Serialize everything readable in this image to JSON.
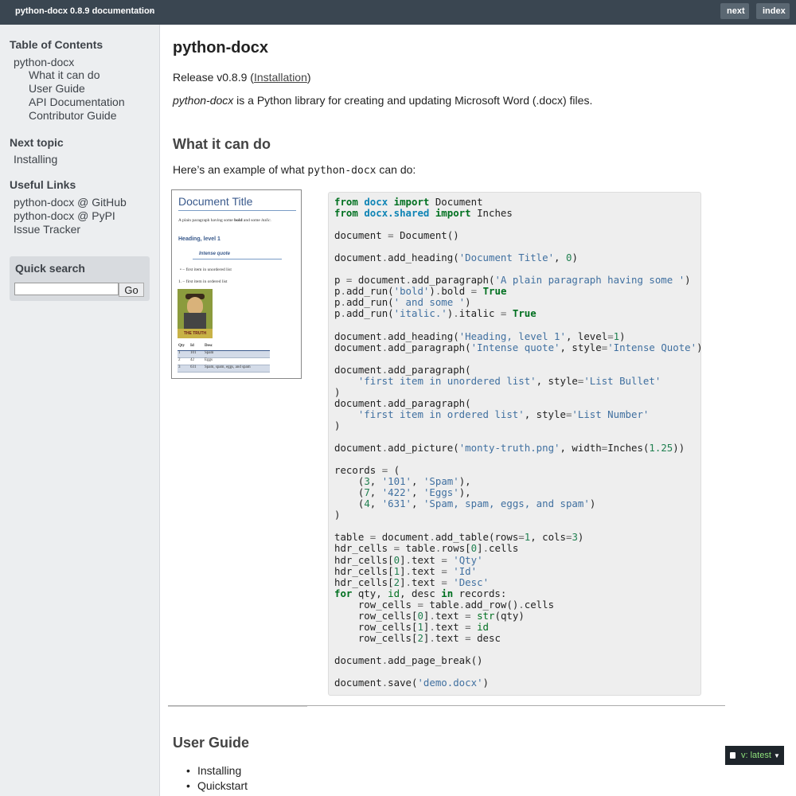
{
  "topbar": {
    "brand": "python-docx 0.8.9 documentation",
    "separator": "»",
    "next": "next",
    "index": "index"
  },
  "sidebar": {
    "toc_title": "Table of Contents",
    "toc": [
      "python-docx",
      "What it can do",
      "User Guide",
      "API Documentation",
      "Contributor Guide"
    ],
    "next_topic_title": "Next topic",
    "next_topic": "Installing",
    "useful_links_title": "Useful Links",
    "useful_links": [
      "python-docx @ GitHub",
      "python-docx @ PyPI",
      "Issue Tracker"
    ],
    "search_title": "Quick search",
    "search_go": "Go"
  },
  "main": {
    "title": "python-docx",
    "release_prefix": "Release v0.8.9 (",
    "release_link": "Installation",
    "release_suffix": ")",
    "intro_em": "python-docx",
    "intro_rest": " is a Python library for creating and updating Microsoft Word (.docx) files.",
    "section1": "What it can do",
    "example_prefix": "Here’s an example of what ",
    "example_code": "python-docx",
    "example_suffix": " can do:",
    "section2": "User Guide",
    "guide_items": [
      "Installing",
      "Quickstart"
    ]
  },
  "preview": {
    "title": "Document Title",
    "para_a": "A plain paragraph having some ",
    "para_bold": "bold",
    "para_b": " and some ",
    "para_italic": "italic.",
    "heading": "Heading, level 1",
    "quote": "Intense quote",
    "bullet": "first item in unordered list",
    "number": "1.",
    "numbered": "first item in ordered list",
    "pic_caption": "THE TRUTH",
    "table": {
      "header": [
        "Qty",
        "Id",
        "Desc"
      ],
      "rows": [
        [
          "1",
          "101",
          "Spam"
        ],
        [
          "2",
          "42",
          "Eggs"
        ],
        [
          "3",
          "631",
          "Spam, spam, eggs, and spam"
        ]
      ]
    }
  },
  "badge": {
    "label": "v: latest"
  }
}
